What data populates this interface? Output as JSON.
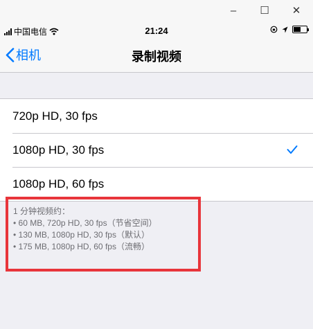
{
  "window": {
    "minimize_glyph": "–",
    "maximize_glyph": "☐",
    "close_glyph": "✕"
  },
  "status_bar": {
    "carrier": "中国电信",
    "time": "21:24",
    "icons": [
      "signal-bars-icon",
      "wifi-icon",
      "orientation-lock-icon",
      "location-arrow-icon",
      "battery-icon"
    ],
    "battery_level": 0.6
  },
  "nav": {
    "back_label": "相机",
    "title": "录制视频"
  },
  "options": [
    {
      "label": "720p HD, 30 fps",
      "selected": false
    },
    {
      "label": "1080p HD, 30 fps",
      "selected": true
    },
    {
      "label": "1080p HD, 60 fps",
      "selected": false
    }
  ],
  "note": {
    "heading": "1 分钟视频约：",
    "lines": [
      "• 60 MB, 720p HD, 30 fps（节省空间）",
      "• 130 MB, 1080p HD, 30 fps（默认）",
      "• 175 MB, 1080p HD, 60 fps（流畅）"
    ]
  },
  "colors": {
    "accent": "#007aff",
    "highlight_box": "#e8353b",
    "background": "#efeff4"
  }
}
